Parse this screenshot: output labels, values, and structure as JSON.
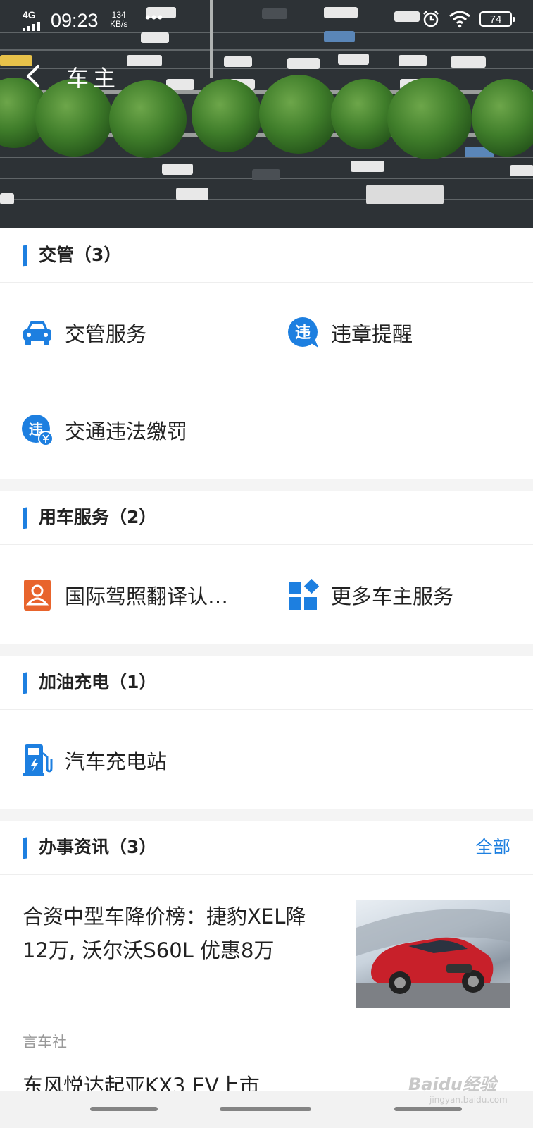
{
  "status_bar": {
    "network": "4G",
    "time": "09:23",
    "speed_value": "134",
    "speed_unit": "KB/s",
    "more": "•••",
    "battery": "74"
  },
  "nav": {
    "title": "车主"
  },
  "sections": {
    "traffic": {
      "title": "交管（3）",
      "items": [
        {
          "label": "交管服务",
          "icon": "car-icon"
        },
        {
          "label": "违章提醒",
          "icon": "violation-icon"
        },
        {
          "label": "交通违法缴罚",
          "icon": "violation-payment-icon"
        }
      ]
    },
    "car_service": {
      "title": "用车服务（2）",
      "items": [
        {
          "label": "国际驾照翻译认…",
          "icon": "license-icon"
        },
        {
          "label": "更多车主服务",
          "icon": "grid-icon"
        }
      ]
    },
    "fuel": {
      "title": "加油充电（1）",
      "items": [
        {
          "label": "汽车充电站",
          "icon": "charging-station-icon"
        }
      ]
    },
    "news": {
      "title": "办事资讯（3）",
      "more": "全部",
      "items": [
        {
          "title": "合资中型车降价榜：捷豹XEL降12万, 沃尔沃S60L 优惠8万",
          "source": "言车社"
        },
        {
          "title": "东风悦达起亚KX3 EV上市"
        }
      ]
    }
  },
  "icon_glyphs": {
    "violation": "违"
  },
  "colors": {
    "accent": "#1d7fe0",
    "license_orange": "#e8642c"
  },
  "watermark": {
    "brand": "Baidu经验",
    "url": "jingyan.baidu.com"
  }
}
